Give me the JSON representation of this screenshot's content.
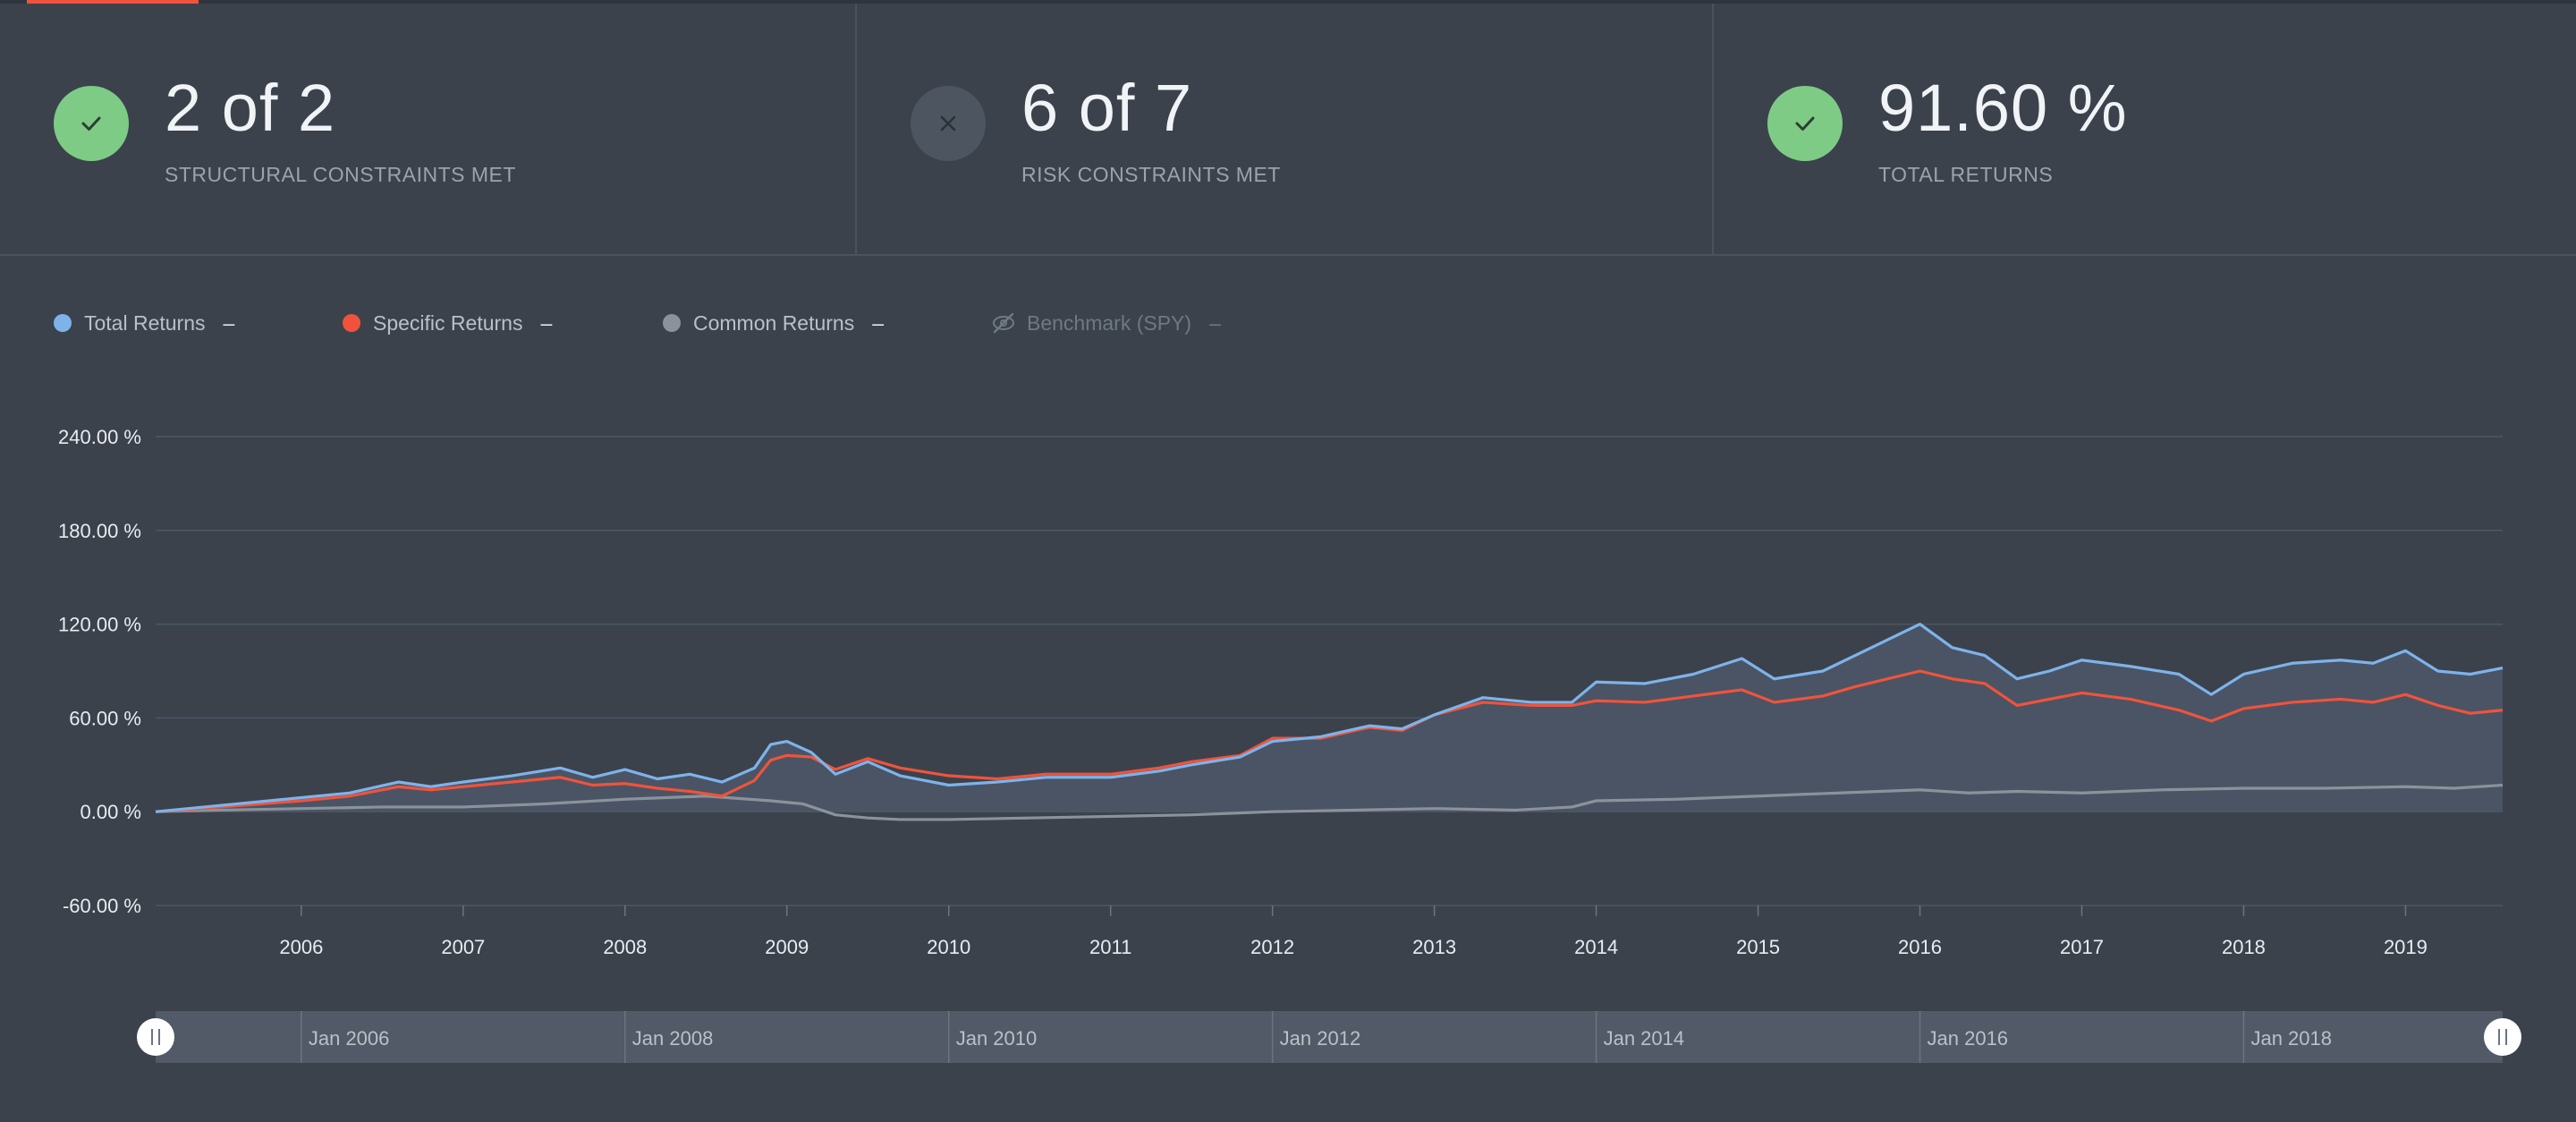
{
  "summary": {
    "cards": [
      {
        "value": "2 of 2",
        "label": "STRUCTURAL CONSTRAINTS MET",
        "status": "ok",
        "icon": "check-icon"
      },
      {
        "value": "6 of 7",
        "label": "RISK CONSTRAINTS MET",
        "status": "fail",
        "icon": "close-icon"
      },
      {
        "value": "91.60 %",
        "label": "TOTAL RETURNS",
        "status": "ok",
        "icon": "check-icon"
      }
    ]
  },
  "legend": [
    {
      "name": "Total Returns",
      "value": "–",
      "color": "#7eb3ea",
      "icon": "dot-icon"
    },
    {
      "name": "Specific Returns",
      "value": "–",
      "color": "#f0533c",
      "icon": "dot-icon"
    },
    {
      "name": "Common Returns",
      "value": "–",
      "color": "#8a929b",
      "icon": "dot-icon"
    },
    {
      "name": "Benchmark (SPY)",
      "value": "–",
      "color": "#6f7883",
      "icon": "eye-off-icon"
    }
  ],
  "navigator": {
    "labels": [
      "Jan 2006",
      "Jan 2008",
      "Jan 2010",
      "Jan 2012",
      "Jan 2014",
      "Jan 2016",
      "Jan 2018"
    ]
  },
  "chart_data": {
    "type": "line",
    "ylim": [
      -60,
      240
    ],
    "yticks": [
      240,
      180,
      120,
      60,
      0,
      -60
    ],
    "ytick_labels": [
      "240.00 %",
      "180.00 %",
      "120.00 %",
      "60.00 %",
      "0.00 %",
      "-60.00 %"
    ],
    "xlim": [
      2005.1,
      2019.6
    ],
    "xticks": [
      2006,
      2007,
      2008,
      2009,
      2010,
      2011,
      2012,
      2013,
      2014,
      2015,
      2016,
      2017,
      2018,
      2019
    ],
    "xtick_labels": [
      "2006",
      "2007",
      "2008",
      "2009",
      "2010",
      "2011",
      "2012",
      "2013",
      "2014",
      "2015",
      "2016",
      "2017",
      "2018",
      "2019"
    ],
    "area_series": "Total Returns",
    "series": [
      {
        "name": "Total Returns",
        "color": "#7eb3ea",
        "x": [
          2005.1,
          2005.5,
          2006.0,
          2006.3,
          2006.6,
          2006.8,
          2007.0,
          2007.3,
          2007.6,
          2007.8,
          2008.0,
          2008.2,
          2008.4,
          2008.6,
          2008.8,
          2008.9,
          2009.0,
          2009.15,
          2009.3,
          2009.5,
          2009.7,
          2010.0,
          2010.3,
          2010.6,
          2011.0,
          2011.3,
          2011.5,
          2011.8,
          2012.0,
          2012.3,
          2012.6,
          2012.8,
          2013.0,
          2013.3,
          2013.6,
          2013.85,
          2014.0,
          2014.3,
          2014.6,
          2014.9,
          2015.1,
          2015.4,
          2015.6,
          2015.8,
          2016.0,
          2016.2,
          2016.4,
          2016.6,
          2016.8,
          2017.0,
          2017.3,
          2017.6,
          2017.8,
          2018.0,
          2018.3,
          2018.6,
          2018.8,
          2019.0,
          2019.2,
          2019.4,
          2019.6
        ],
        "y": [
          0,
          4,
          9,
          12,
          19,
          16,
          19,
          23,
          28,
          22,
          27,
          21,
          24,
          19,
          28,
          43,
          45,
          38,
          24,
          32,
          23,
          17,
          19,
          22,
          22,
          26,
          30,
          35,
          45,
          48,
          55,
          53,
          62,
          73,
          70,
          70,
          83,
          82,
          88,
          98,
          85,
          90,
          100,
          110,
          120,
          105,
          100,
          85,
          90,
          97,
          93,
          88,
          75,
          88,
          95,
          97,
          95,
          103,
          90,
          88,
          92
        ]
      },
      {
        "name": "Specific Returns",
        "color": "#f0533c",
        "x": [
          2005.1,
          2005.5,
          2006.0,
          2006.3,
          2006.6,
          2006.8,
          2007.0,
          2007.3,
          2007.6,
          2007.8,
          2008.0,
          2008.2,
          2008.4,
          2008.6,
          2008.8,
          2008.9,
          2009.0,
          2009.15,
          2009.3,
          2009.5,
          2009.7,
          2010.0,
          2010.3,
          2010.6,
          2011.0,
          2011.3,
          2011.5,
          2011.8,
          2012.0,
          2012.3,
          2012.6,
          2012.8,
          2013.0,
          2013.3,
          2013.6,
          2013.85,
          2014.0,
          2014.3,
          2014.6,
          2014.9,
          2015.1,
          2015.4,
          2015.6,
          2015.8,
          2016.0,
          2016.2,
          2016.4,
          2016.6,
          2016.8,
          2017.0,
          2017.3,
          2017.6,
          2017.8,
          2018.0,
          2018.3,
          2018.6,
          2018.8,
          2019.0,
          2019.2,
          2019.4,
          2019.6
        ],
        "y": [
          0,
          3,
          7,
          10,
          16,
          14,
          16,
          19,
          22,
          17,
          18,
          15,
          13,
          10,
          20,
          33,
          36,
          35,
          27,
          34,
          28,
          23,
          21,
          24,
          24,
          28,
          32,
          36,
          47,
          47,
          54,
          52,
          62,
          70,
          68,
          68,
          71,
          70,
          74,
          78,
          70,
          74,
          80,
          85,
          90,
          85,
          82,
          68,
          72,
          76,
          72,
          65,
          58,
          66,
          70,
          72,
          70,
          75,
          68,
          63,
          65
        ]
      },
      {
        "name": "Common Returns",
        "color": "#8a929b",
        "x": [
          2005.1,
          2005.5,
          2006.0,
          2006.5,
          2007.0,
          2007.5,
          2008.0,
          2008.5,
          2008.9,
          2009.1,
          2009.3,
          2009.5,
          2009.7,
          2010.0,
          2010.5,
          2011.0,
          2011.5,
          2012.0,
          2012.5,
          2013.0,
          2013.5,
          2013.85,
          2014.0,
          2014.5,
          2015.0,
          2015.5,
          2016.0,
          2016.3,
          2016.6,
          2017.0,
          2017.5,
          2018.0,
          2018.5,
          2019.0,
          2019.3,
          2019.6
        ],
        "y": [
          0,
          1,
          2,
          3,
          3,
          5,
          8,
          10,
          7,
          5,
          -2,
          -4,
          -5,
          -5,
          -4,
          -3,
          -2,
          0,
          1,
          2,
          1,
          3,
          7,
          8,
          10,
          12,
          14,
          12,
          13,
          12,
          14,
          15,
          15,
          16,
          15,
          17
        ]
      }
    ]
  }
}
